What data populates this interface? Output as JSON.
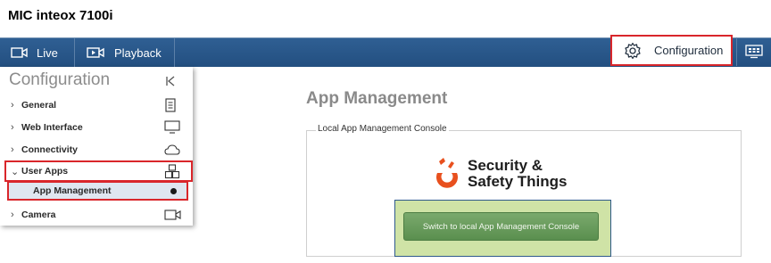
{
  "device": {
    "title": "MIC inteox 7100i"
  },
  "nav": {
    "live_label": "Live",
    "playback_label": "Playback",
    "configuration_label": "Configuration"
  },
  "sidebar": {
    "title": "Configuration",
    "items": [
      {
        "label": "General",
        "icon": "document-icon"
      },
      {
        "label": "Web Interface",
        "icon": "monitor-icon"
      },
      {
        "label": "Connectivity",
        "icon": "cloud-icon"
      },
      {
        "label": "User Apps",
        "icon": "cubes-icon"
      },
      {
        "label": "Camera",
        "icon": "video-camera-icon"
      }
    ],
    "sub_item": {
      "label": "App Management"
    }
  },
  "main": {
    "title": "App Management",
    "fieldset_legend": "Local App Management Console",
    "logo_text_line1": "Security &",
    "logo_text_line2": "Safety Things",
    "console_button_label": "Switch to local App Management Console"
  },
  "colors": {
    "navbar": "#2a5688",
    "highlight_red": "#d9262b",
    "console_green": "#5a8f4f",
    "logo_orange": "#e8501e"
  }
}
